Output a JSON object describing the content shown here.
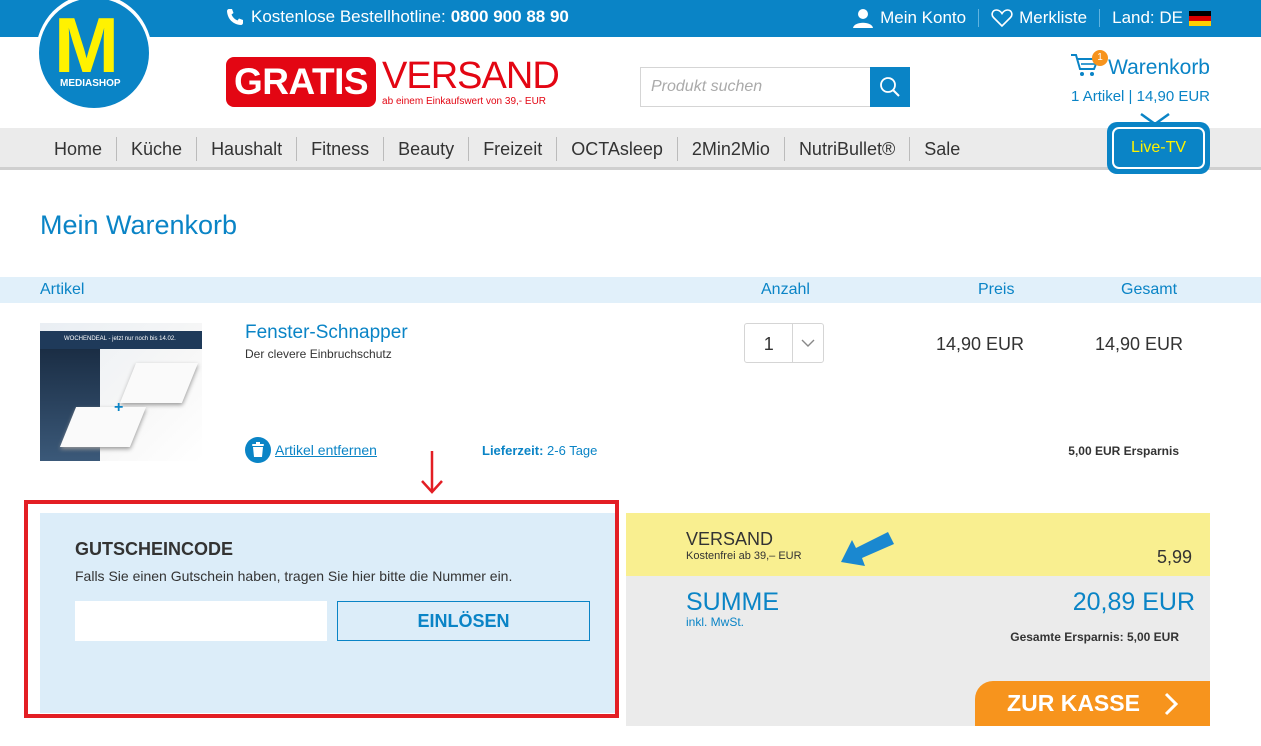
{
  "topbar": {
    "hotline_label": "Kostenlose Bestellhotline:",
    "hotline_number": "0800 900 88 90",
    "account": "Mein Konto",
    "wishlist": "Merkliste",
    "country": "Land: DE"
  },
  "logo": {
    "letter": "M",
    "text": "MEDIASHOP"
  },
  "promo": {
    "gratis": "GRATIS",
    "versand": "VERSAND",
    "subtext": "ab einem Einkaufswert von 39,- EUR"
  },
  "search": {
    "placeholder": "Produkt suchen",
    "icon": "search-icon"
  },
  "cart": {
    "title": "Warenkorb",
    "badge": "1",
    "summary": "1 Artikel | 14,90 EUR"
  },
  "nav": {
    "items": [
      "Home",
      "Küche",
      "Haushalt",
      "Fitness",
      "Beauty",
      "Freizeit",
      "OCTAsleep",
      "2Min2Mio",
      "NutriBullet®",
      "Sale"
    ],
    "live_tv": "Live-TV"
  },
  "page": {
    "title": "Mein Warenkorb"
  },
  "table": {
    "headers": {
      "article": "Artikel",
      "qty": "Anzahl",
      "price": "Preis",
      "total": "Gesamt"
    }
  },
  "item": {
    "image_banner": "WOCHENDEAL - jetzt nur noch bis 14.02.",
    "name": "Fenster-Schnapper",
    "subtitle": "Der clevere Einbruchschutz",
    "qty": "1",
    "price": "14,90 EUR",
    "total": "14,90 EUR",
    "remove": "Artikel entfernen",
    "delivery_label": "Lieferzeit:",
    "delivery_value": "2-6 Tage",
    "savings": "5,00 EUR Ersparnis"
  },
  "voucher": {
    "title": "GUTSCHEINCODE",
    "text": "Falls Sie einen Gutschein haben, tragen Sie hier bitte die Nummer ein.",
    "input_value": "",
    "button": "EINLÖSEN"
  },
  "summary": {
    "shipping_label": "VERSAND",
    "shipping_note": "Kostenfrei ab 39,– EUR",
    "shipping_value": "5,99",
    "sum_label": "SUMME",
    "sum_note": "inkl. MwSt.",
    "sum_value": "20,89 EUR",
    "total_savings": "Gesamte Ersparnis: 5,00 EUR",
    "checkout": "ZUR KASSE"
  },
  "colors": {
    "brand_blue": "#0a84c6",
    "accent_yellow": "#fff200",
    "promo_red": "#e30613",
    "checkout_orange": "#f7941d",
    "highlight_red": "#e31e24"
  }
}
